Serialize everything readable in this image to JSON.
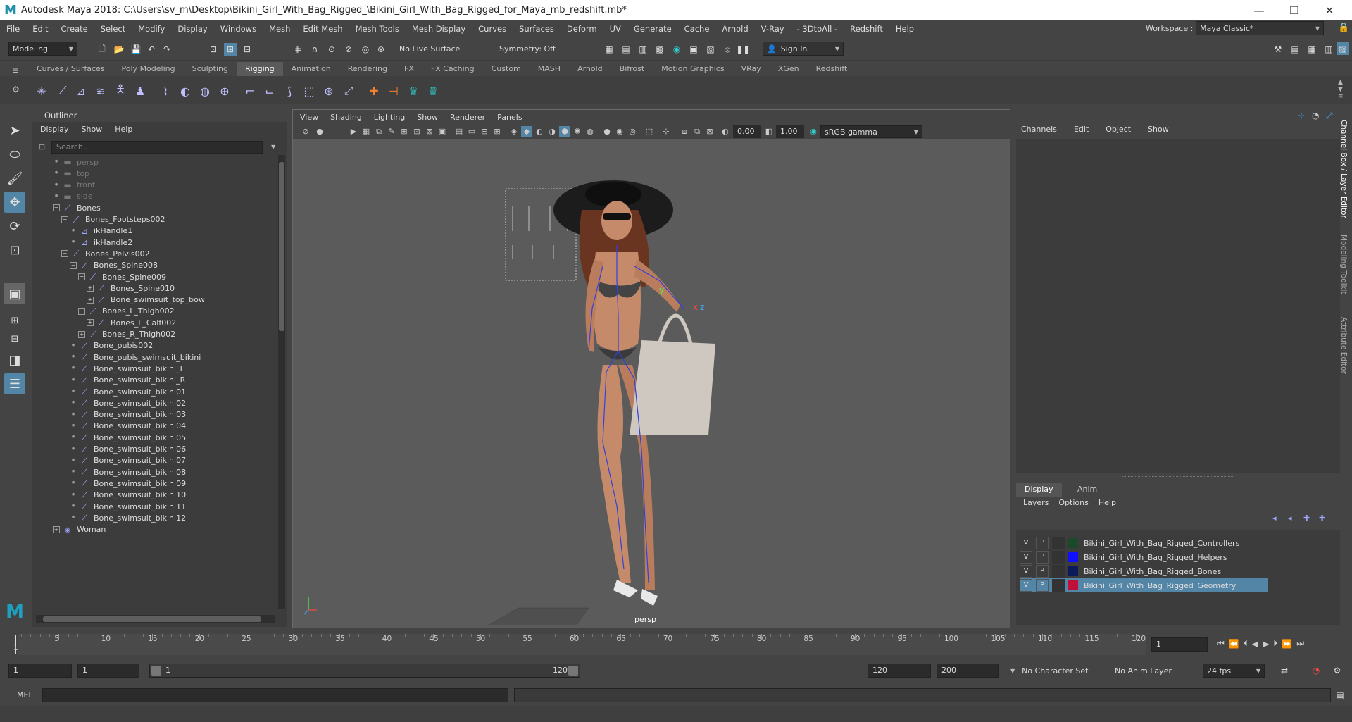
{
  "window": {
    "title": "Autodesk Maya 2018: C:\\Users\\sv_m\\Desktop\\Bikini_Girl_With_Bag_Rigged_\\Bikini_Girl_With_Bag_Rigged_for_Maya_mb_redshift.mb*",
    "logo": "M"
  },
  "menubar": {
    "items": [
      "File",
      "Edit",
      "Create",
      "Select",
      "Modify",
      "Display",
      "Windows",
      "Mesh",
      "Edit Mesh",
      "Mesh Tools",
      "Mesh Display",
      "Curves",
      "Surfaces",
      "Deform",
      "UV",
      "Generate",
      "Cache",
      "Arnold",
      "V-Ray",
      "- 3DtoAll -",
      "Redshift",
      "Help"
    ],
    "workspace_label": "Workspace :",
    "workspace_value": "Maya Classic*"
  },
  "statusline": {
    "mode": "Modeling",
    "live_surface": "No Live Surface",
    "symmetry": "Symmetry: Off",
    "sign_in": "Sign In"
  },
  "shelf": {
    "tabs": [
      "Curves / Surfaces",
      "Poly Modeling",
      "Sculpting",
      "Rigging",
      "Animation",
      "Rendering",
      "FX",
      "FX Caching",
      "Custom",
      "MASH",
      "Arnold",
      "Bifrost",
      "Motion Graphics",
      "VRay",
      "XGen",
      "Redshift"
    ],
    "active_tab": "Rigging"
  },
  "outliner": {
    "title": "Outliner",
    "menu": [
      "Display",
      "Show",
      "Help"
    ],
    "search_placeholder": "Search...",
    "nodes": [
      {
        "label": "persp",
        "depth": 0,
        "icon": "camera-icon",
        "exp": "",
        "dim": true
      },
      {
        "label": "top",
        "depth": 0,
        "icon": "camera-icon",
        "exp": "",
        "dim": true
      },
      {
        "label": "front",
        "depth": 0,
        "icon": "camera-icon",
        "exp": "",
        "dim": true
      },
      {
        "label": "side",
        "depth": 0,
        "icon": "camera-icon",
        "exp": "",
        "dim": true
      },
      {
        "label": "Bones",
        "depth": 0,
        "icon": "joint-icon",
        "exp": "−",
        "dim": false
      },
      {
        "label": "Bones_Footsteps002",
        "depth": 1,
        "icon": "joint-icon",
        "exp": "−",
        "dim": false
      },
      {
        "label": "ikHandle1",
        "depth": 2,
        "icon": "ik-handle-icon",
        "exp": "",
        "dim": false
      },
      {
        "label": "ikHandle2",
        "depth": 2,
        "icon": "ik-handle-icon",
        "exp": "",
        "dim": false
      },
      {
        "label": "Bones_Pelvis002",
        "depth": 1,
        "icon": "joint-icon",
        "exp": "−",
        "dim": false
      },
      {
        "label": "Bones_Spine008",
        "depth": 2,
        "icon": "joint-icon",
        "exp": "−",
        "dim": false
      },
      {
        "label": "Bones_Spine009",
        "depth": 3,
        "icon": "joint-icon",
        "exp": "−",
        "dim": false
      },
      {
        "label": "Bones_Spine010",
        "depth": 4,
        "icon": "joint-icon",
        "exp": "+",
        "dim": false
      },
      {
        "label": "Bone_swimsuit_top_bow",
        "depth": 4,
        "icon": "joint-icon",
        "exp": "+",
        "dim": false
      },
      {
        "label": "Bones_L_Thigh002",
        "depth": 3,
        "icon": "joint-icon",
        "exp": "−",
        "dim": false
      },
      {
        "label": "Bones_L_Calf002",
        "depth": 4,
        "icon": "joint-icon",
        "exp": "+",
        "dim": false
      },
      {
        "label": "Bones_R_Thigh002",
        "depth": 3,
        "icon": "joint-icon",
        "exp": "+",
        "dim": false
      },
      {
        "label": "Bone_pubis002",
        "depth": 2,
        "icon": "joint-icon",
        "exp": "",
        "dim": false
      },
      {
        "label": "Bone_pubis_swimsuit_bikini",
        "depth": 2,
        "icon": "joint-icon",
        "exp": "",
        "dim": false
      },
      {
        "label": "Bone_swimsuit_bikini_L",
        "depth": 2,
        "icon": "joint-icon",
        "exp": "",
        "dim": false
      },
      {
        "label": "Bone_swimsuit_bikini_R",
        "depth": 2,
        "icon": "joint-icon",
        "exp": "",
        "dim": false
      },
      {
        "label": "Bone_swimsuit_bikini01",
        "depth": 2,
        "icon": "joint-icon",
        "exp": "",
        "dim": false
      },
      {
        "label": "Bone_swimsuit_bikini02",
        "depth": 2,
        "icon": "joint-icon",
        "exp": "",
        "dim": false
      },
      {
        "label": "Bone_swimsuit_bikini03",
        "depth": 2,
        "icon": "joint-icon",
        "exp": "",
        "dim": false
      },
      {
        "label": "Bone_swimsuit_bikini04",
        "depth": 2,
        "icon": "joint-icon",
        "exp": "",
        "dim": false
      },
      {
        "label": "Bone_swimsuit_bikini05",
        "depth": 2,
        "icon": "joint-icon",
        "exp": "",
        "dim": false
      },
      {
        "label": "Bone_swimsuit_bikini06",
        "depth": 2,
        "icon": "joint-icon",
        "exp": "",
        "dim": false
      },
      {
        "label": "Bone_swimsuit_bikini07",
        "depth": 2,
        "icon": "joint-icon",
        "exp": "",
        "dim": false
      },
      {
        "label": "Bone_swimsuit_bikini08",
        "depth": 2,
        "icon": "joint-icon",
        "exp": "",
        "dim": false
      },
      {
        "label": "Bone_swimsuit_bikini09",
        "depth": 2,
        "icon": "joint-icon",
        "exp": "",
        "dim": false
      },
      {
        "label": "Bone_swimsuit_bikini10",
        "depth": 2,
        "icon": "joint-icon",
        "exp": "",
        "dim": false
      },
      {
        "label": "Bone_swimsuit_bikini11",
        "depth": 2,
        "icon": "joint-icon",
        "exp": "",
        "dim": false
      },
      {
        "label": "Bone_swimsuit_bikini12",
        "depth": 2,
        "icon": "joint-icon",
        "exp": "",
        "dim": false
      },
      {
        "label": "Woman",
        "depth": 0,
        "icon": "mesh-icon",
        "exp": "+",
        "dim": false
      }
    ]
  },
  "viewport": {
    "menu": [
      "View",
      "Shading",
      "Lighting",
      "Show",
      "Renderer",
      "Panels"
    ],
    "exposure": "0.00",
    "gamma": "1.00",
    "color_space": "sRGB gamma",
    "camera_label": "persp"
  },
  "channelbox": {
    "menu": [
      "Channels",
      "Edit",
      "Object",
      "Show"
    ]
  },
  "sidetabs": [
    "Channel Box / Layer Editor",
    "Modeling Toolkit",
    "Attribute Editor"
  ],
  "layereditor": {
    "tabs": [
      "Display",
      "Anim"
    ],
    "menu": [
      "Layers",
      "Options",
      "Help"
    ],
    "layers": [
      {
        "v": "V",
        "p": "P",
        "name": "Bikini_Girl_With_Bag_Rigged_Controllers",
        "color": "#1a4a2a",
        "selected": false
      },
      {
        "v": "V",
        "p": "P",
        "name": "Bikini_Girl_With_Bag_Rigged_Helpers",
        "color": "#1010ff",
        "selected": false
      },
      {
        "v": "V",
        "p": "P",
        "name": "Bikini_Girl_With_Bag_Rigged_Bones",
        "color": "#0a1a5a",
        "selected": false
      },
      {
        "v": "V",
        "p": "P",
        "name": "Bikini_Girl_With_Bag_Rigged_Geometry",
        "color": "#c0103a",
        "selected": true
      }
    ]
  },
  "timeslider": {
    "start_tick": "1",
    "labels": [
      "5",
      "10",
      "15",
      "20",
      "25",
      "30",
      "35",
      "40",
      "45",
      "50",
      "55",
      "60",
      "65",
      "70",
      "75",
      "80",
      "85",
      "90",
      "95",
      "100",
      "105",
      "110",
      "115",
      "120"
    ],
    "current_frame": "1"
  },
  "rangeslider": {
    "start": "1",
    "anim_start": "1",
    "range_start": "1",
    "range_end": "120",
    "anim_end": "120",
    "end": "200",
    "character_set": "No Character Set",
    "anim_layer": "No Anim Layer",
    "fps": "24 fps"
  },
  "cmdline": {
    "label": "MEL"
  },
  "colors": {
    "accent": "#5285a6",
    "panel": "#444444",
    "viewport": "#5b5b5b"
  }
}
